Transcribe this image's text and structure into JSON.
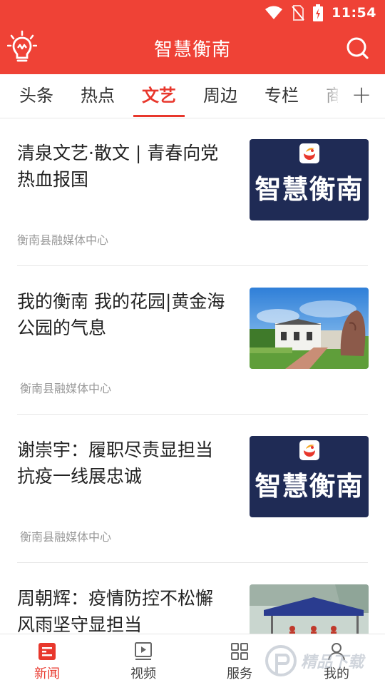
{
  "status_bar": {
    "time": "11:54",
    "icons": [
      "wifi-icon",
      "no-sim-icon",
      "battery-charging-icon"
    ]
  },
  "header": {
    "title": "智慧衡南",
    "left_icon": "lightbulb-icon",
    "right_icon": "search-icon"
  },
  "tabs": {
    "items": [
      "头条",
      "热点",
      "文艺",
      "周边",
      "专栏",
      "商"
    ],
    "active": "文艺",
    "add_label": "+"
  },
  "news": [
    {
      "title_line1": "清泉文艺·散文 | 青春向党",
      "title_line2": "热血报国",
      "source": "衡南县融媒体中心",
      "thumb_text": "智慧衡南"
    },
    {
      "title_line1": "我的衡南 我的花园|黄金海",
      "title_line2": "公园的气息",
      "source": "衡南县融媒体中心",
      "thumb_text": ""
    },
    {
      "title_line1": "谢崇宇：履职尽责显担当",
      "title_line2": "抗疫一线展忠诚",
      "source": "衡南县融媒体中心",
      "thumb_text": "智慧衡南"
    },
    {
      "title_line1": "周朝辉：疫情防控不松懈",
      "title_line2": "风雨坚守显担当",
      "source": "",
      "thumb_text": ""
    }
  ],
  "bottom_nav": {
    "items": [
      {
        "label": "新闻",
        "icon": "news-icon"
      },
      {
        "label": "视频",
        "icon": "video-icon"
      },
      {
        "label": "服务",
        "icon": "grid-icon"
      },
      {
        "label": "我的",
        "icon": "user-icon"
      }
    ],
    "active": "新闻"
  },
  "watermark": {
    "text": "精品下载"
  },
  "colors": {
    "brand_red": "#ef4236",
    "active_tab": "#e8372c",
    "thumb_navy": "#1f2b55"
  }
}
